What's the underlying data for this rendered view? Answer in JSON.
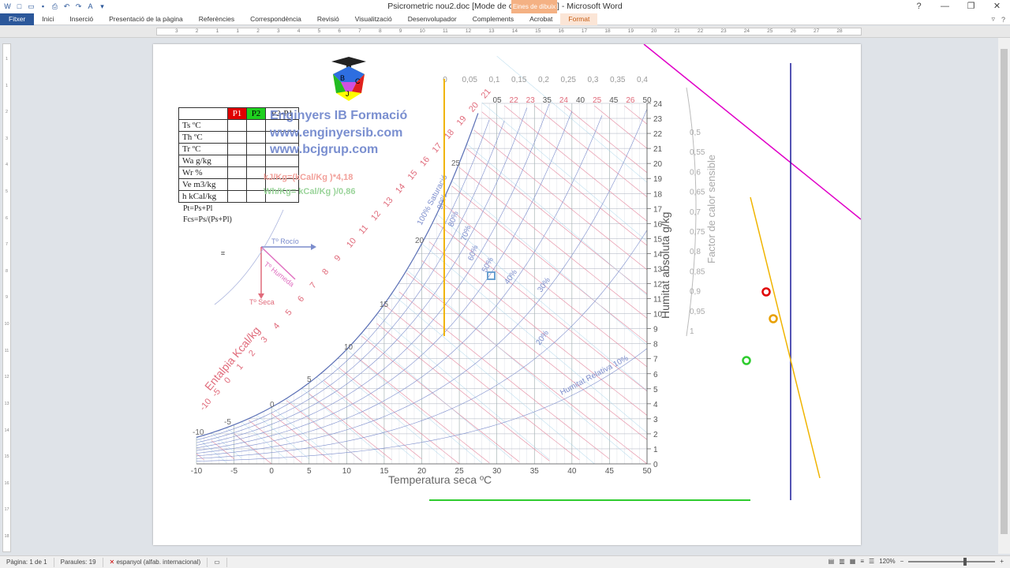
{
  "window": {
    "title": "Psicrometric nou2.doc [Mode de compatibilitat] - Microsoft Word",
    "context_tab": "Eines de dibuix"
  },
  "ribbon": {
    "tabs": [
      "Fitxer",
      "Inici",
      "Inserció",
      "Presentació de la pàgina",
      "Referències",
      "Correspondència",
      "Revisió",
      "Visualització",
      "Desenvolupador",
      "Complements",
      "Acrobat",
      "Format"
    ]
  },
  "ruler": {
    "marks": [
      "3",
      "2",
      "1",
      "1",
      "2",
      "3",
      "4",
      "5",
      "6",
      "7",
      "8",
      "9",
      "10",
      "11",
      "12",
      "13",
      "14",
      "15",
      "16",
      "17",
      "18",
      "19",
      "20",
      "21",
      "22",
      "23",
      "24",
      "25",
      "26",
      "27",
      "28"
    ]
  },
  "document": {
    "logo_letters": [
      "B",
      "C",
      "J"
    ],
    "table": {
      "headers": [
        "",
        "P1",
        "P2",
        "P2-P1"
      ],
      "rows": [
        "Ts ºC",
        "Th ºC",
        "Tr ºC",
        "Wa g/kg",
        "Wr %",
        "Ve m3/kg",
        "h kCal/kg"
      ]
    },
    "formula1": "Pt=Ps+Pl",
    "formula2": "Fcs=Ps/(Ps+Pl)",
    "brand1": "Enginyers IB Formació",
    "brand2": "www.enginyersib.com",
    "brand3": "www.bcjgrup.com",
    "conv1": "kJ/Kg=(kCal/Kg )*4,18",
    "conv2": "Wh/Kg= kCal/Kg )/0,86",
    "legend": {
      "rocio": "Tº Rocío",
      "humeda": "Tº Humeda",
      "seca": "Tº Seca"
    }
  },
  "chart_data": {
    "type": "line",
    "title": "",
    "xlabel": "Temperatura seca ºC",
    "ylabel": "Humitat absoluta g/kg",
    "y2label": "Factor de calor sensible",
    "enthalpy_label": "Entalpia Kcal/kg",
    "x_ticks": [
      -10,
      -5,
      0,
      5,
      10,
      15,
      20,
      25,
      30,
      35,
      40,
      45,
      50
    ],
    "y_ticks": [
      0,
      1,
      2,
      3,
      4,
      5,
      6,
      7,
      8,
      9,
      10,
      11,
      12,
      13,
      14,
      15,
      16,
      17,
      18,
      19,
      20,
      21,
      22,
      23,
      24
    ],
    "top_ticks": [
      "0",
      "0,05",
      "0,1",
      "0,15",
      "0,2",
      "0,25",
      "0,3",
      "0,35",
      "0,4"
    ],
    "top_temp_ticks": [
      "05",
      "22",
      "23",
      "35",
      "24",
      "40",
      "25",
      "45",
      "26",
      "50"
    ],
    "enthalpy_ticks": [
      -10,
      -5,
      0,
      1,
      2,
      3,
      4,
      5,
      6,
      7,
      8,
      9,
      10,
      11,
      12,
      13,
      14,
      15,
      16,
      17,
      18,
      19,
      20,
      21
    ],
    "wet_bulb_ticks": [
      -10,
      -5,
      0,
      5,
      10,
      15,
      20,
      25
    ],
    "fcs_ticks": [
      "0,5",
      "0,55",
      "0,6",
      "0,65",
      "0,7",
      "0,75",
      "0,8",
      "0,85",
      "0,9",
      "0,95",
      "1"
    ],
    "rh_labels": [
      "100% Saturació",
      "90%",
      "80%",
      "70%",
      "60%",
      "50%",
      "40%",
      "30%",
      "20%",
      "Humitat Relativa 10%"
    ],
    "saturation_curve": {
      "x": [
        -10,
        -5,
        0,
        5,
        10,
        15,
        20,
        25,
        30
      ],
      "y": [
        1.6,
        2.5,
        3.8,
        5.4,
        7.6,
        10.6,
        14.7,
        20.0,
        27.2
      ]
    },
    "ylim": [
      0,
      24
    ],
    "xlim": [
      -10,
      50
    ],
    "grid": true,
    "markers": [
      {
        "color": "#e00000"
      },
      {
        "color": "#e8a000"
      },
      {
        "color": "#2ecc2e"
      }
    ]
  },
  "status": {
    "page": "Pàgina: 1 de 1",
    "words": "Paraules: 19",
    "lang": "espanyol (alfab. internacional)",
    "zoom": "120%"
  }
}
